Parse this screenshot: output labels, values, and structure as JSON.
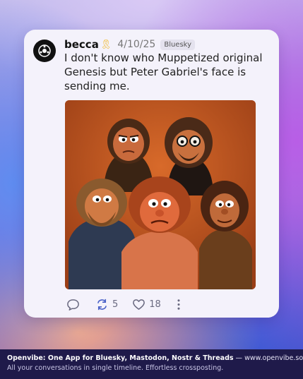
{
  "post": {
    "author": "becca",
    "author_badge_icon": "awareness-ribbon-icon",
    "date": "4/10/25",
    "network": "Bluesky",
    "text": "I don't know who Muppetized original Genesis but Peter Gabriel's face is sending me.",
    "image_alt": "Five muppet-style puppets posed as a band portrait",
    "actions": {
      "reply_icon": "reply-icon",
      "repost_icon": "repost-icon",
      "repost_count": "5",
      "like_icon": "heart-icon",
      "like_count": "18",
      "more_icon": "more-vertical-icon"
    }
  },
  "footer": {
    "brand_line": "Openvibe: One App for Bluesky, Mastodon, Nostr & Threads",
    "separator": " — ",
    "url": "www.openvibe.social",
    "tagline": "All your conversations in single timeline. Effortless crossposting."
  },
  "colors": {
    "card_bg": "#f4f2fb",
    "footer_bg": "#1f1a4a",
    "icon_gray": "#6a6a80",
    "ribbon": "#f0b622",
    "repost_accent": "#4a62c8"
  }
}
